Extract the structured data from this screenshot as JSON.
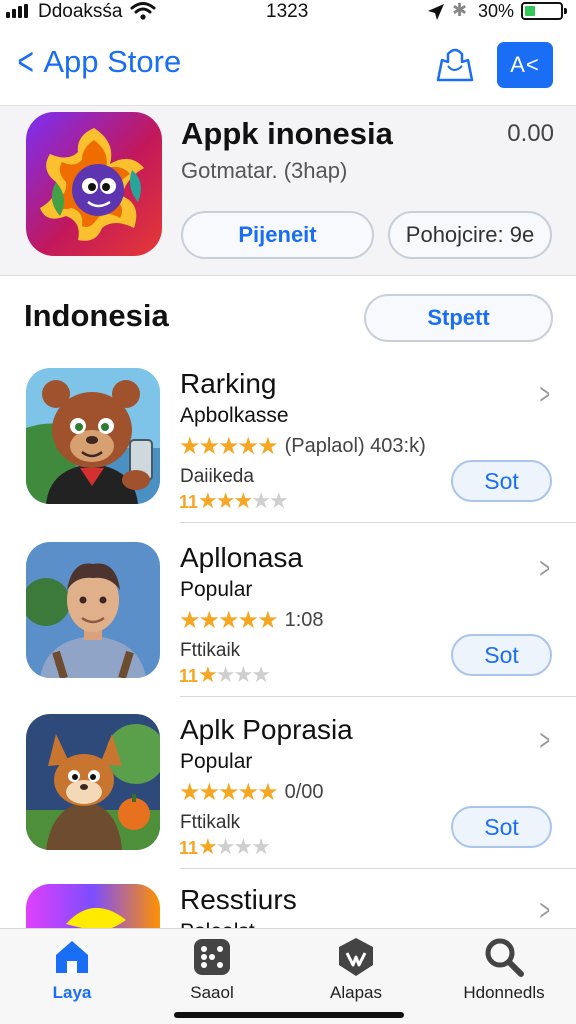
{
  "status_bar": {
    "carrier": "Ddoaksśa",
    "time": "1323",
    "battery_percent": "30%",
    "battery_level": 0.3
  },
  "nav": {
    "back_label": "App Store",
    "action_label": "A<"
  },
  "featured": {
    "title": "Appk inonesia",
    "price": "0.00",
    "subtitle": "Gotmatar. (3hap)",
    "primary_button": "Pijeneit",
    "secondary_button": "Pohojcire: 9e"
  },
  "section": {
    "title": "Indonesia",
    "button": "Stpett"
  },
  "list": [
    {
      "name": "Rarking",
      "category": "Apbolkasse",
      "rating_meta": "(Paplaol) 403:k)",
      "sub_label": "Daiikeda",
      "small_rating_num": "11",
      "small_rating": 3,
      "get_label": "Sot"
    },
    {
      "name": "Apllonasa",
      "category": "Popular",
      "rating_meta": "1:08",
      "sub_label": "Fttikaik",
      "small_rating_num": "11",
      "small_rating": 1,
      "get_label": "Sot"
    },
    {
      "name": "Aplk Poprasia",
      "category": "Popular",
      "rating_meta": "0/00",
      "sub_label": "Fttikalk",
      "small_rating_num": "11",
      "small_rating": 1,
      "get_label": "Sot"
    },
    {
      "name": "Resstiurs",
      "category": "Polealst"
    }
  ],
  "tabs": [
    {
      "label": "Laya",
      "icon": "house-icon",
      "active": true
    },
    {
      "label": "Saaol",
      "icon": "dice-icon",
      "active": false
    },
    {
      "label": "Alapas",
      "icon": "shield-icon",
      "active": false
    },
    {
      "label": "Hdonnedls",
      "icon": "search-icon",
      "active": false
    }
  ],
  "colors": {
    "accent": "#1a6ef5",
    "star": "#f5a623",
    "battery": "#34c759"
  }
}
